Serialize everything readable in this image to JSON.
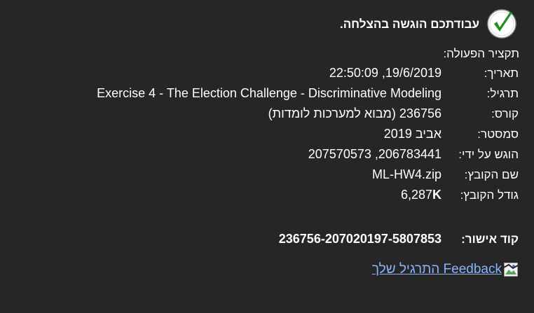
{
  "success_message": "עבודתכם הוגשה בהצלחה.",
  "summary_title": "תקציר הפעולה:",
  "details": [
    {
      "label": "תאריך:",
      "value": "19/6/2019, 22:50:09"
    },
    {
      "label": "תרגיל:",
      "value": "Exercise 4 - The Election Challenge - Discriminative Modeling"
    },
    {
      "label": "קורס:",
      "value": "236756 (מבוא למערכות לומדות)"
    },
    {
      "label": "סמסטר:",
      "value": "אביב 2019"
    },
    {
      "label": "הוגש על ידי:",
      "value": "206783441, 207570573"
    },
    {
      "label": "שם הקובץ:",
      "value": "ML-HW4.zip"
    },
    {
      "label": "גודל הקובץ:",
      "value": "6,287",
      "unit": "K"
    }
  ],
  "approval": {
    "label": "קוד אישור:",
    "value": "236756-207020197-5807853"
  },
  "feedback": {
    "label": "Feedback התרגיל שלך",
    "icon": "broken-image-icon"
  },
  "colors": {
    "background": "#262626",
    "text": "#ffffff",
    "link": "#8ab4f8",
    "check_green": "#1e8f1e"
  }
}
